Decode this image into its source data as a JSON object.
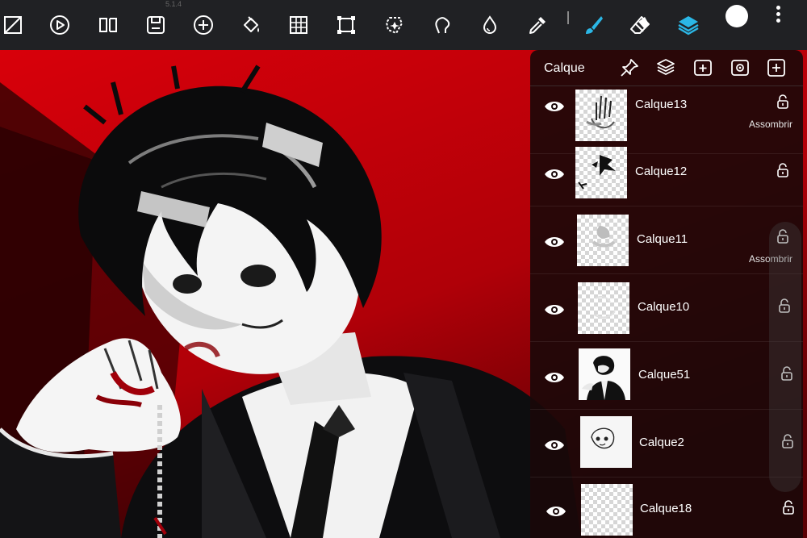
{
  "app": {
    "version": "5.1.4"
  },
  "toolbar": {
    "tools": [
      {
        "name": "selection-icon",
        "interactive": true
      },
      {
        "name": "play-icon",
        "interactive": true
      },
      {
        "name": "split-view-icon",
        "interactive": true
      },
      {
        "name": "save-icon",
        "interactive": true
      },
      {
        "name": "add-icon",
        "interactive": true
      },
      {
        "name": "fill-bucket-icon",
        "interactive": true
      },
      {
        "name": "grid-icon",
        "interactive": true
      },
      {
        "name": "transform-icon",
        "interactive": true
      },
      {
        "name": "magic-wand-icon",
        "interactive": true
      },
      {
        "name": "smudge-icon",
        "interactive": true
      },
      {
        "name": "blur-drop-icon",
        "interactive": true
      },
      {
        "name": "eyedropper-icon",
        "interactive": true
      },
      {
        "name": "brush-icon",
        "interactive": true
      },
      {
        "name": "eraser-icon",
        "interactive": true
      },
      {
        "name": "layers-icon",
        "interactive": true
      }
    ],
    "accent_color": "#2bb7e6",
    "current_color": "#ffffff"
  },
  "layers_panel": {
    "title": "Calque",
    "header_icons": [
      "pin-icon",
      "layer-merge-icon",
      "add-layer-folder-icon",
      "layer-settings-icon",
      "add-layer-icon"
    ],
    "layers": [
      {
        "name": "Calque13",
        "blend_mode": "Assombrir",
        "visible": true,
        "thumb": "hand-sketch"
      },
      {
        "name": "Calque12",
        "blend_mode": "",
        "visible": true,
        "thumb": "hair-strokes"
      },
      {
        "name": "Calque11",
        "blend_mode": "Assombrir",
        "visible": true,
        "thumb": "gray-shading"
      },
      {
        "name": "Calque10",
        "blend_mode": "",
        "visible": true,
        "thumb": "faint-lines"
      },
      {
        "name": "Calque51",
        "blend_mode": "",
        "visible": true,
        "thumb": "character-bw"
      },
      {
        "name": "Calque2",
        "blend_mode": "",
        "visible": true,
        "thumb": "face-lineart"
      },
      {
        "name": "Calque18",
        "blend_mode": "",
        "visible": true,
        "thumb": "empty"
      }
    ]
  },
  "canvas": {
    "background_color": "#c30008"
  }
}
